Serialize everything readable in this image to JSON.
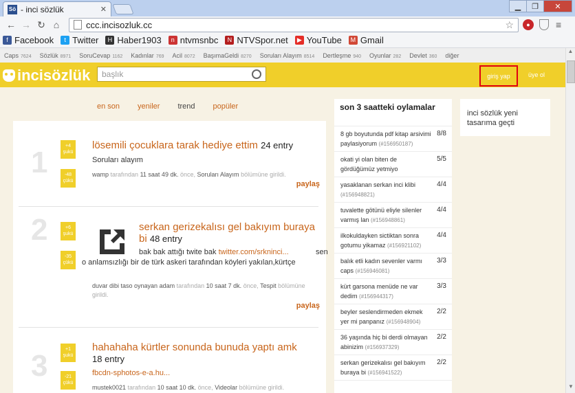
{
  "browser": {
    "tab_title": "- inci sözlük",
    "favicon_text": "Sö",
    "url": "ccc.incisozluk.cc"
  },
  "bookmarks": [
    {
      "label": "Facebook",
      "color": "#3b5998"
    },
    {
      "label": "Twitter",
      "color": "#1da1f2"
    },
    {
      "label": "Haber1903",
      "color": "#333333"
    },
    {
      "label": "ntvmsnbc",
      "color": "#cc3333"
    },
    {
      "label": "NTVSpor.net",
      "color": "#b41e1e"
    },
    {
      "label": "YouTube",
      "color": "#e52d27"
    },
    {
      "label": "Gmail",
      "color": "#d14836"
    }
  ],
  "categories": [
    {
      "name": "Caps",
      "count": "7624"
    },
    {
      "name": "Sözlük",
      "count": "8971"
    },
    {
      "name": "SoruCevap",
      "count": "1162"
    },
    {
      "name": "Kadınlar",
      "count": "769"
    },
    {
      "name": "Acil",
      "count": "8072"
    },
    {
      "name": "BaşımaGeldi",
      "count": "8270"
    },
    {
      "name": "Soruları Alayım",
      "count": "8514"
    },
    {
      "name": "Dertleşme",
      "count": "940"
    },
    {
      "name": "Oyunlar",
      "count": "282"
    },
    {
      "name": "Devlet",
      "count": "360"
    },
    {
      "name": "diğer",
      "count": ""
    }
  ],
  "header": {
    "logo": "incisözlük",
    "search_placeholder": "başlık",
    "login": "giriş yap",
    "signup": "üye ol",
    "brand_color": "#f0cf2a"
  },
  "filters": [
    "en son",
    "yeniler",
    "trend",
    "popüler"
  ],
  "entries": [
    {
      "rank": "1",
      "up": "+4",
      "up_label": "şukü",
      "down": "-48",
      "down_label": "çükü",
      "title": "lösemili çocuklara tarak hediye ettim",
      "count": "24 entry",
      "body": "Soruları alayım",
      "link": "",
      "body_tail": "",
      "author": "wamp",
      "by": "tarafından",
      "time": "11 saat 49 dk.",
      "ago": "önce,",
      "section": "Soruları Alayım",
      "section_suffix": "bölümüne girildi.",
      "share": "paylaş"
    },
    {
      "rank": "2",
      "up": "+6",
      "up_label": "şukü",
      "down": "-35",
      "down_label": "çükü",
      "title": "serkan gerizekalısı gel bakıyım buraya bi",
      "count": "48 entry",
      "body": "bak bak attığı twite bak",
      "link": "twitter.com/srkninci...",
      "body_tail": "sen o anlamsızlığı bir de türk askeri tarafından köyleri yakılan,kürtçe",
      "author": "duvar dibi taso oynayan adam",
      "by": "tarafından",
      "time": "10 saat 7 dk.",
      "ago": "önce,",
      "section": "Tespit",
      "section_suffix": "bölümüne girildi.",
      "share": "paylaş"
    },
    {
      "rank": "3",
      "up": "+1",
      "up_label": "şukü",
      "down": "-21",
      "down_label": "çükü",
      "title": "hahahaha kürtler sonunda bunuda yaptı amk",
      "count": "18 entry",
      "body": "",
      "link": "fbcdn-sphotos-e-a.hu...",
      "body_tail": "",
      "author": "mustek0021",
      "by": "tarafından",
      "time": "10 saat 10 dk.",
      "ago": "önce,",
      "section": "Videolar",
      "section_suffix": "bölümüne girildi.",
      "share": "paylaş"
    }
  ],
  "sidebar": {
    "title": "son 3 saatteki oylamalar",
    "items": [
      {
        "text": "8 gb boyutunda pdf kitap arsivimi paylasiyorum",
        "id": "(#156950187)",
        "score": "8/8"
      },
      {
        "text": "okati yi olan biten de gördüğümüz yetmiyo",
        "id": "(#156926097)",
        "score": "5/5"
      },
      {
        "text": "yasaklanan serkan inci klibi",
        "id": "(#156948821)",
        "score": "4/4"
      },
      {
        "text": "tuvalette götünü eliyle silenler varmış lan",
        "id": "(#156948861)",
        "score": "4/4"
      },
      {
        "text": "ilkokuldayken sictiktan sonra gotumu yikamaz",
        "id": "(#156921102)",
        "score": "4/4"
      },
      {
        "text": "balık etli kadın sevenler varmı caps",
        "id": "(#156946081)",
        "score": "3/3"
      },
      {
        "text": "kürt garsona menüde ne var dedim",
        "id": "(#156944317)",
        "score": "3/3"
      },
      {
        "text": "beyler seslendirmeden ekmek yer mi panpanız",
        "id": "(#156948904)",
        "score": "2/2"
      },
      {
        "text": "36 yaşında hiç bi derdi olmayan abinizim",
        "id": "(#156937329)",
        "score": "2/2"
      },
      {
        "text": "serkan gerizekalısı gel bakıyım buraya bi",
        "id": "(#156941522)",
        "score": "2/2"
      }
    ]
  },
  "note": "inci sözlük yeni tasarıma geçti"
}
